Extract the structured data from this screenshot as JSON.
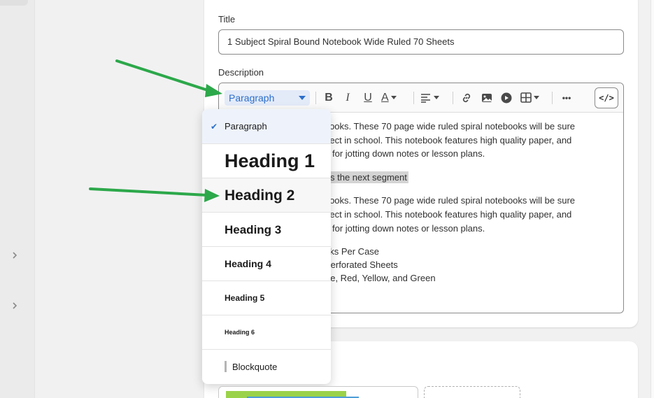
{
  "form": {
    "title_label": "Title",
    "title_value": "1 Subject Spiral Bound Notebook Wide Ruled 70 Sheets",
    "description_label": "Description"
  },
  "toolbar": {
    "paragraph_select": "Paragraph",
    "bold": "B",
    "italic": "I",
    "underline": "U",
    "text_color": "A",
    "more": "•••",
    "code": "</>"
  },
  "editor_lines": {
    "l1": "tebooks. These 70 page wide ruled spiral notebooks will be sure",
    "l2": "ubject in school. This notebook features high quality paper, and",
    "l3": "for jotting down notes or lesson plans.",
    "l4": "s the next segment",
    "l5": "tebooks. These 70 page wide ruled spiral notebooks will be sure",
    "l6": "ubject in school. This notebook features high quality paper, and",
    "l7": "for jotting down notes or lesson plans.",
    "l8": "oks Per Case",
    "l9": "Perforated Sheets",
    "l10": "ue, Red, Yellow, and Green"
  },
  "dropdown": {
    "check": "✔",
    "items": [
      {
        "label": "Paragraph"
      },
      {
        "label": "Heading 1"
      },
      {
        "label": "Heading 2"
      },
      {
        "label": "Heading 3"
      },
      {
        "label": "Heading 4"
      },
      {
        "label": "Heading 5"
      },
      {
        "label": "Heading 6"
      },
      {
        "label": "Blockquote"
      }
    ]
  },
  "colors": {
    "accent": "#2c6ecb",
    "arrow": "#2ca84a",
    "highlight": "#d4d4d4"
  },
  "icons": [
    "chevron-right-icon",
    "chevron-right-icon",
    "link-icon",
    "image-icon",
    "video-icon",
    "table-icon",
    "align-left-icon",
    "check-icon"
  ]
}
